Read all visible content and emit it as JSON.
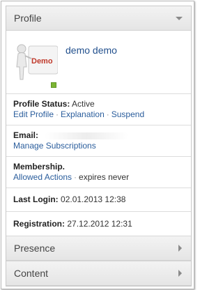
{
  "sections": {
    "profile": {
      "title": "Profile"
    },
    "presence": {
      "title": "Presence"
    },
    "content": {
      "title": "Content"
    }
  },
  "user": {
    "display_name": "demo demo",
    "avatar_sign_text": "Demo"
  },
  "status": {
    "label": "Profile Status:",
    "value": "Active",
    "actions": [
      "Edit Profile",
      "Explanation",
      "Suspend"
    ]
  },
  "email": {
    "label": "Email:",
    "manage_link": "Manage Subscriptions"
  },
  "membership": {
    "label": "Membership.",
    "allowed_actions": "Allowed Actions",
    "expiry": "expires never"
  },
  "last_login": {
    "label": "Last Login:",
    "value": "02.01.2013 12:38"
  },
  "registration": {
    "label": "Registration:",
    "value": "27.12.2012 12:31"
  },
  "colors": {
    "link": "#2a5d9c",
    "online": "#7cb534",
    "sign_text": "#c0392b"
  }
}
